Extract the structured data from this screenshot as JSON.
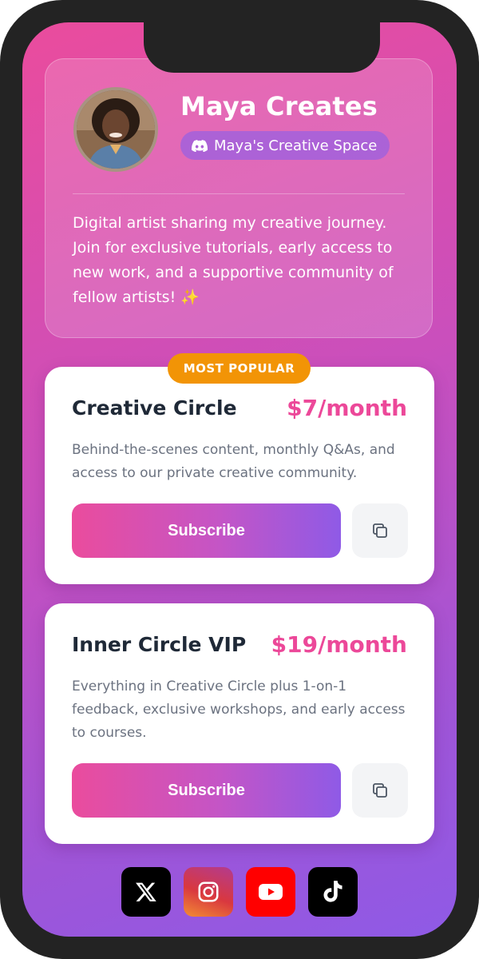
{
  "profile": {
    "name": "Maya Creates",
    "discord_label": "Maya's Creative Space",
    "bio": "Digital artist sharing my creative journey. Join for exclusive tutorials, early access to new work, and a supportive community of fellow artists! ✨"
  },
  "tiers": [
    {
      "badge": "MOST POPULAR",
      "name": "Creative Circle",
      "price": "$7/month",
      "description": "Behind-the-scenes content, monthly Q&As, and access to our private creative community.",
      "button_label": "Subscribe"
    },
    {
      "name": "Inner Circle VIP",
      "price": "$19/month",
      "description": "Everything in Creative Circle plus 1-on-1 feedback, exclusive workshops, and early access to courses.",
      "button_label": "Subscribe"
    }
  ],
  "socials": [
    {
      "icon": "x-icon"
    },
    {
      "icon": "instagram-icon"
    },
    {
      "icon": "youtube-icon"
    },
    {
      "icon": "tiktok-icon"
    }
  ],
  "colors": {
    "accent_pink": "#ec4899",
    "accent_purple": "#8f5ae6",
    "badge_orange": "#f29406"
  }
}
